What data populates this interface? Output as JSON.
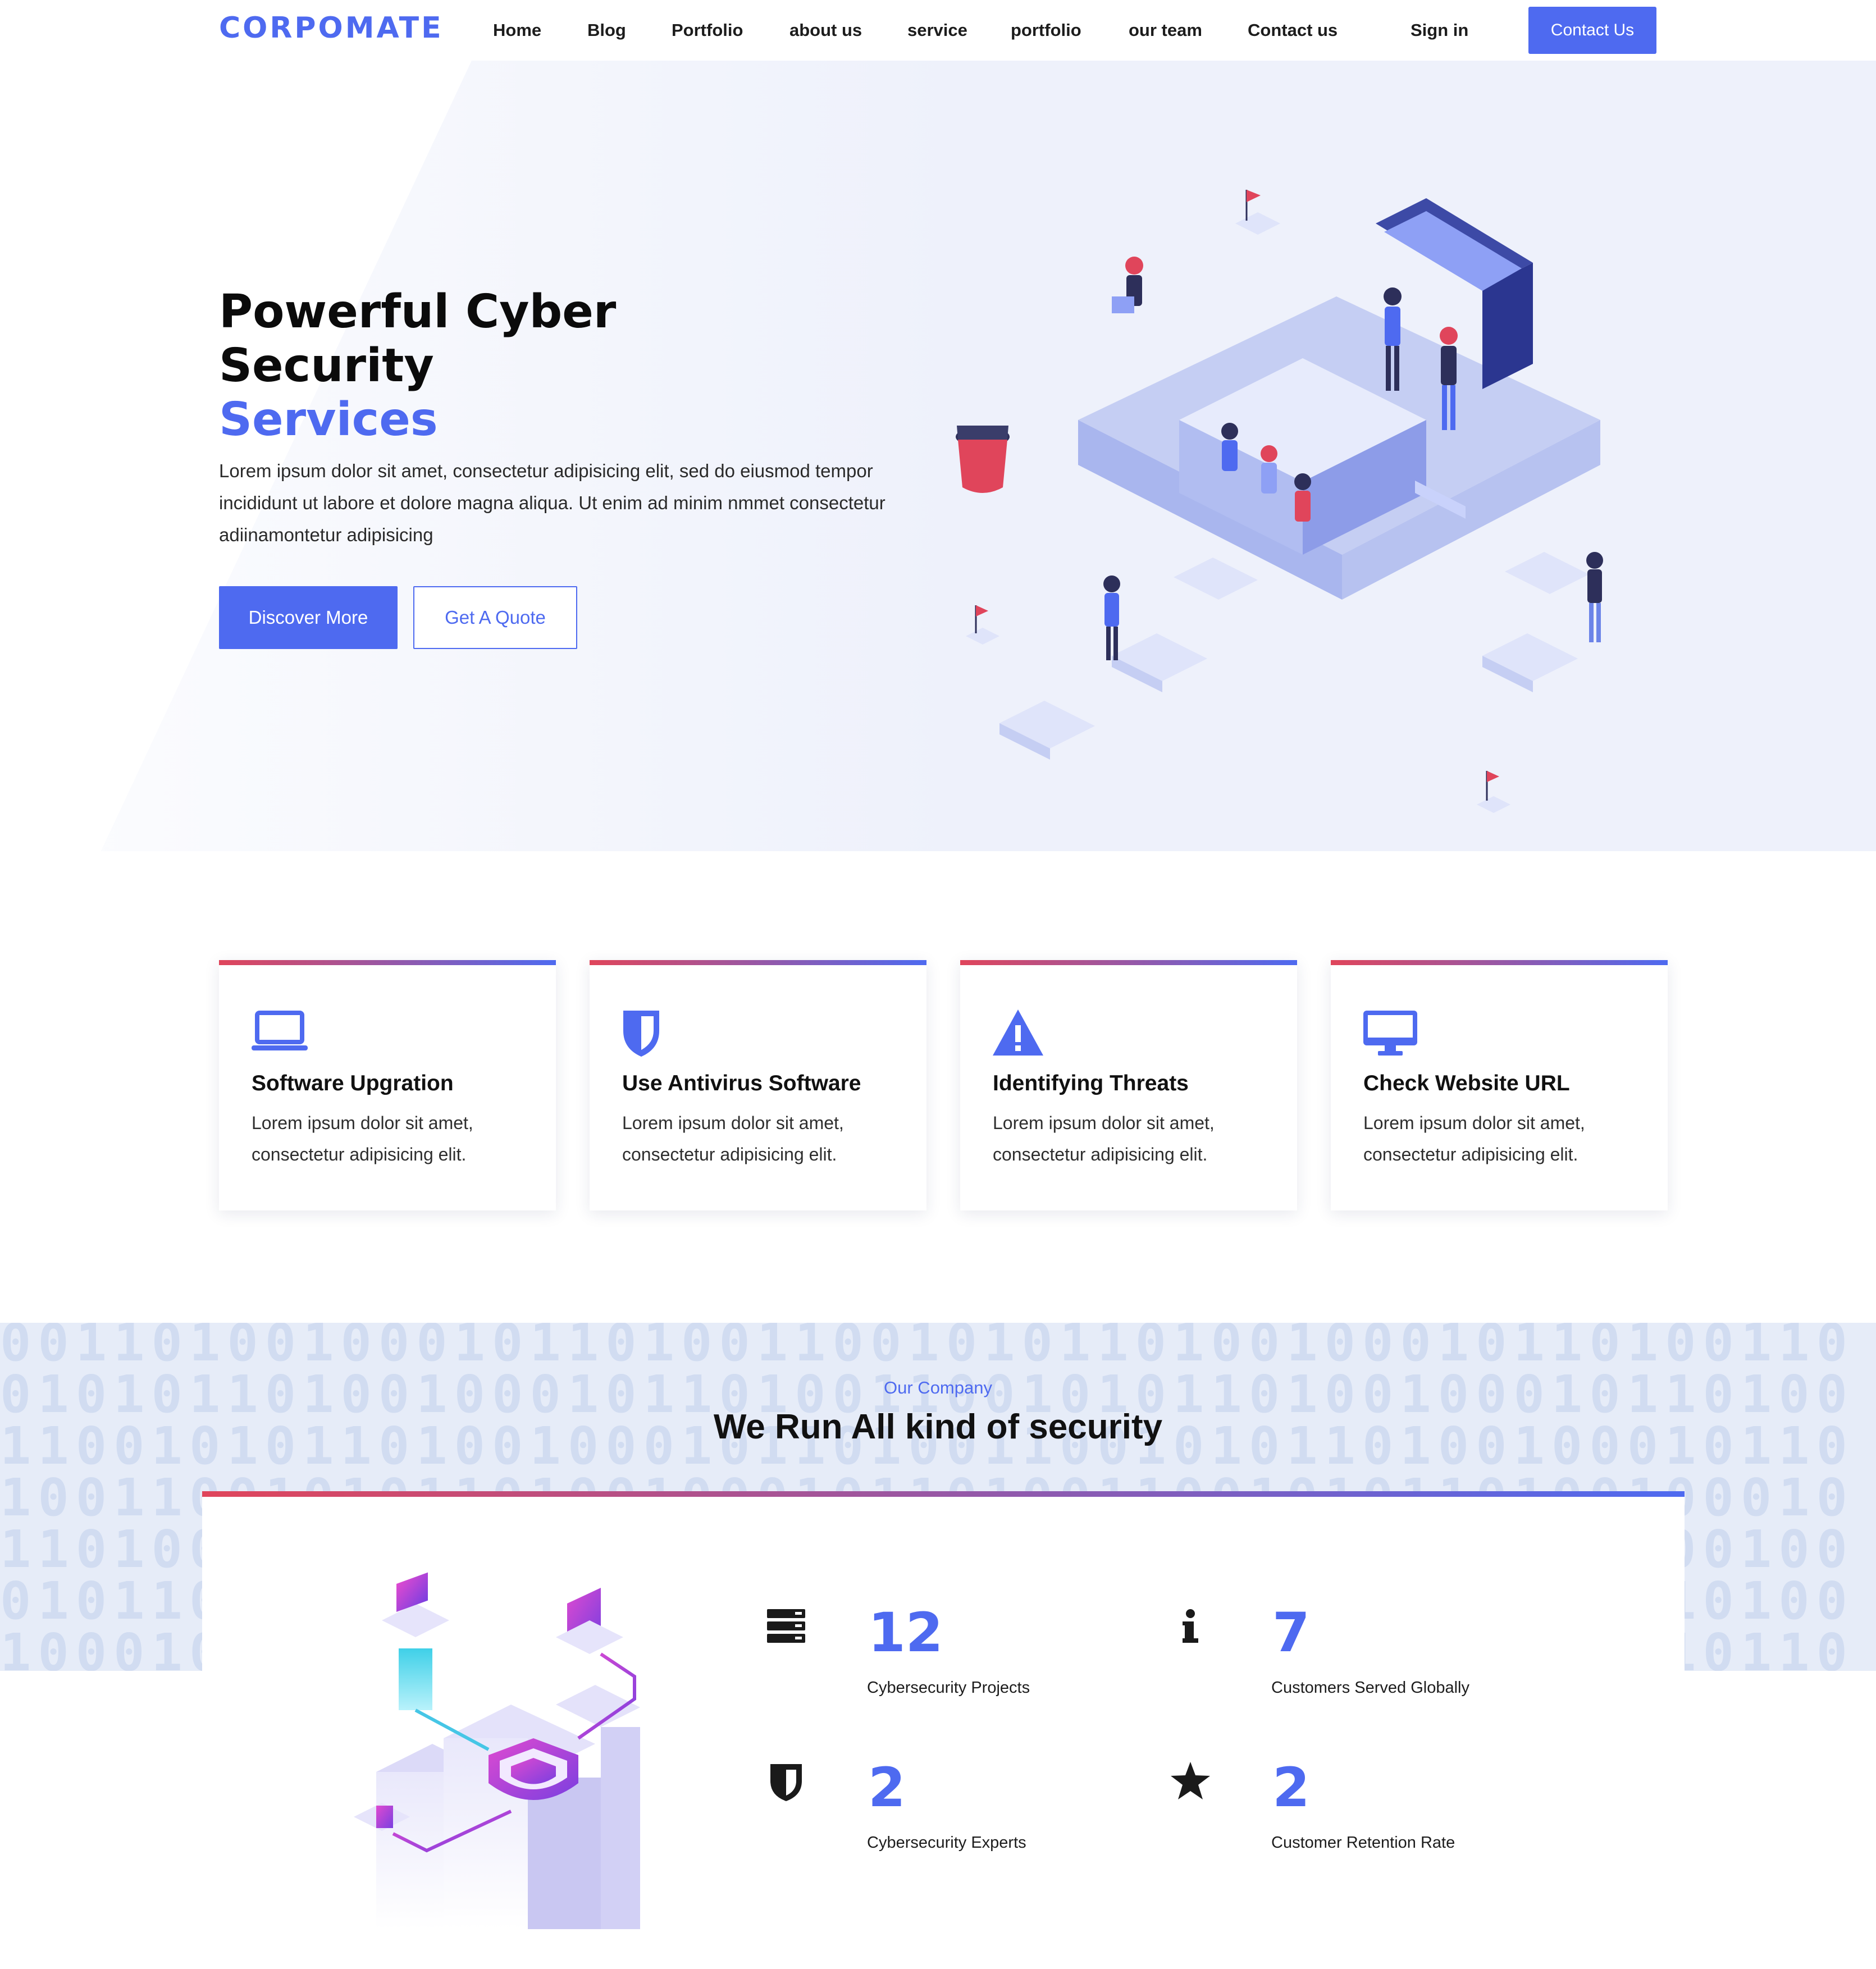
{
  "brand": {
    "logo": "CORPOMATE",
    "accent": "#4e6af0",
    "secondary_accent": "#e0455b"
  },
  "nav": {
    "items": [
      "Home",
      "Blog",
      "Portfolio",
      "about us",
      "service",
      "portfolio",
      "our team",
      "Contact us"
    ],
    "sign_in": "Sign in",
    "contact_button": "Contact Us"
  },
  "hero": {
    "title_line1": "Powerful Cyber",
    "title_line2": "Security",
    "title_accent": "Services",
    "text": "Lorem ipsum dolor sit amet, consectetur adipisicing elit, sed do eiusmod tempor incididunt ut labore et dolore magna aliqua. Ut enim ad minim nmmet consectetur adiinamontetur adipisicing",
    "primary_button": "Discover More",
    "secondary_button": "Get A Quote"
  },
  "features": [
    {
      "icon": "laptop-icon",
      "title": "Software Upgration",
      "text": "Lorem ipsum dolor sit amet, consectetur adipisicing elit."
    },
    {
      "icon": "shield-icon",
      "title": "Use Antivirus Software",
      "text": "Lorem ipsum dolor sit amet, consectetur adipisicing elit."
    },
    {
      "icon": "warning-icon",
      "title": "Identifying Threats",
      "text": "Lorem ipsum dolor sit amet, consectetur adipisicing elit."
    },
    {
      "icon": "desktop-icon",
      "title": "Check Website URL",
      "text": "Lorem ipsum dolor sit amet, consectetur adipisicing elit."
    }
  ],
  "company": {
    "eyebrow": "Our Company",
    "title": "We Run All kind of security",
    "stats": [
      {
        "icon": "server-icon",
        "value": "12",
        "label": "Cybersecurity Projects"
      },
      {
        "icon": "info-icon",
        "value": "7",
        "label": "Customers Served Globally"
      },
      {
        "icon": "shield-icon",
        "value": "2",
        "label": "Cybersecurity Experts"
      },
      {
        "icon": "star-icon",
        "value": "2",
        "label": "Customer Retention Rate"
      }
    ]
  }
}
